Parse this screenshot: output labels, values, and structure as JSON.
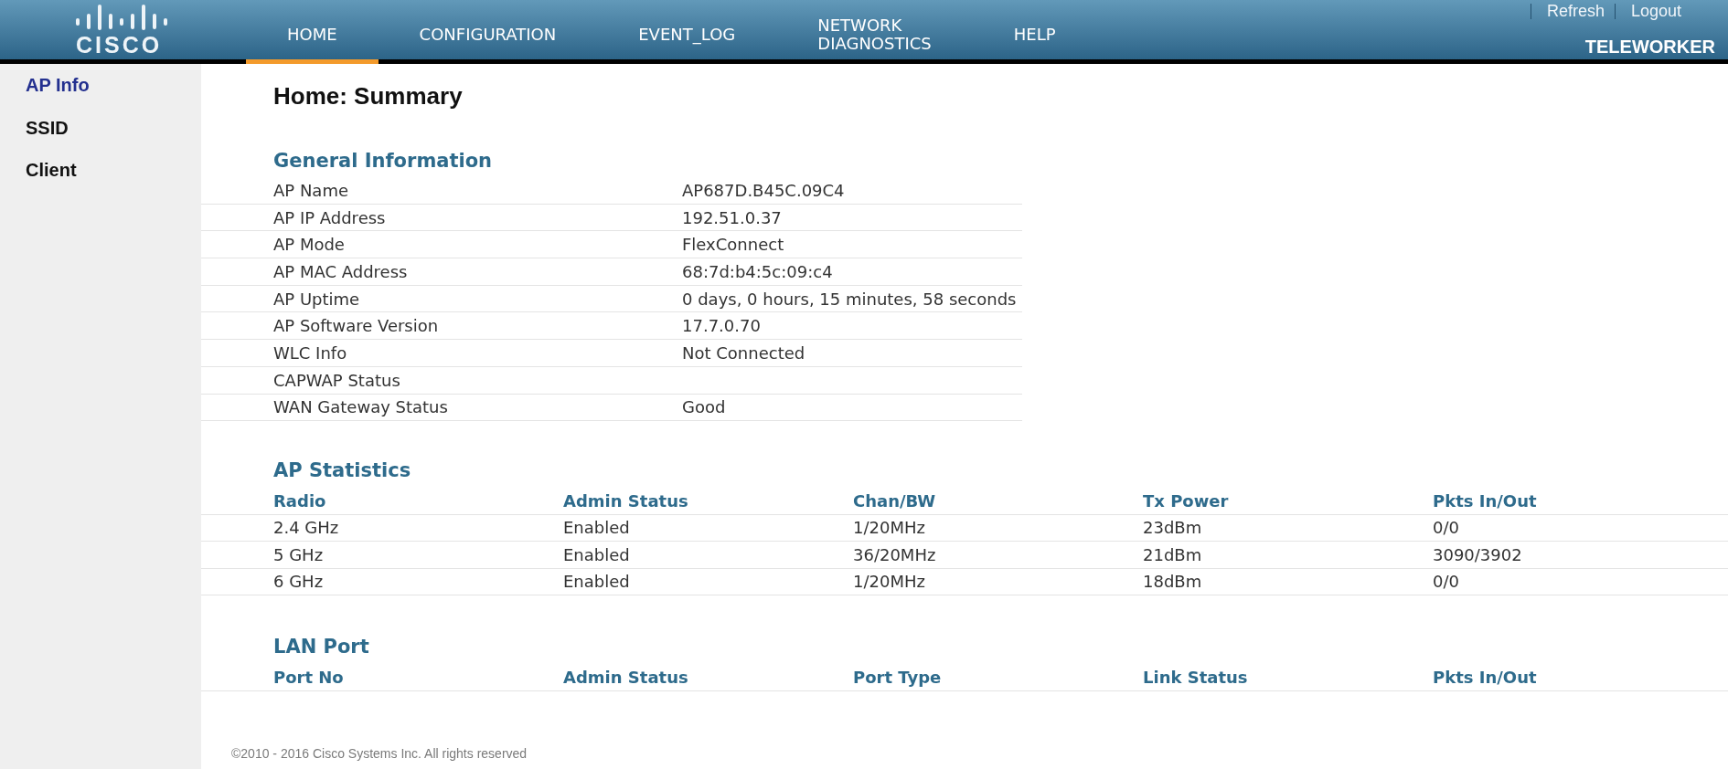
{
  "header": {
    "logo_text": "CISCO",
    "nav_tabs": [
      {
        "label": "HOME",
        "selected": true
      },
      {
        "label": "CONFIGURATION",
        "selected": false
      },
      {
        "label": "EVENT_LOG",
        "selected": false
      },
      {
        "label": "NETWORK DIAGNOSTICS",
        "selected": false
      },
      {
        "label": "HELP",
        "selected": false
      }
    ],
    "links": [
      "Refresh",
      "Logout"
    ],
    "mode": "TELEWORKER"
  },
  "sidebar": {
    "items": [
      {
        "label": "AP Info",
        "selected": true
      },
      {
        "label": "SSID",
        "selected": false
      },
      {
        "label": "Client",
        "selected": false
      }
    ]
  },
  "page_title": "Home: Summary",
  "general_information": {
    "title": "General Information",
    "rows": [
      {
        "label": "AP Name",
        "value": "AP687D.B45C.09C4"
      },
      {
        "label": "AP IP Address",
        "value": "192.51.0.37"
      },
      {
        "label": "AP Mode",
        "value": "FlexConnect"
      },
      {
        "label": "AP MAC Address",
        "value": "68:7d:b4:5c:09:c4"
      },
      {
        "label": "AP Uptime",
        "value": "0 days, 0 hours, 15 minutes, 58 seconds"
      },
      {
        "label": "AP Software Version",
        "value": "17.7.0.70"
      },
      {
        "label": "WLC Info",
        "value": "Not Connected"
      },
      {
        "label": "CAPWAP Status"
      },
      {
        "label": "WAN Gateway Status",
        "value": "Good"
      }
    ]
  },
  "ap_statistics": {
    "title": "AP Statistics",
    "columns": [
      "Radio",
      "Admin Status",
      "Chan/BW",
      "Tx Power",
      "Pkts In/Out"
    ],
    "rows": [
      [
        "2.4 GHz",
        "Enabled",
        "1/20MHz",
        "23dBm",
        "0/0"
      ],
      [
        "5 GHz",
        "Enabled",
        "36/20MHz",
        "21dBm",
        "3090/3902"
      ],
      [
        "6 GHz",
        "Enabled",
        "1/20MHz",
        "18dBm",
        "0/0"
      ]
    ]
  },
  "lan_port": {
    "title": "LAN Port",
    "columns": [
      "Port No",
      "Admin Status",
      "Port Type",
      "Link Status",
      "Pkts In/Out"
    ]
  },
  "footer": "©2010 - 2016 Cisco Systems Inc. All rights reserved"
}
